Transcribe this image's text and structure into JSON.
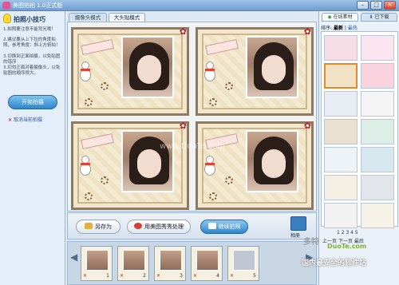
{
  "window": {
    "title": "美图拍拍 1.0正式版",
    "btn_min": "–",
    "btn_max": "□",
    "btn_close": "×"
  },
  "tips": {
    "title": "拍照小技巧",
    "items": [
      "1.拍照要注意不能背光哦！",
      "2.建议要从上下拉的角度拍照，参考角度：斜上方俯拍！",
      "3.切换到正面拍摄，以免贴图的错序",
      "3.切勿正面对着摄像头，以免贴图的顺序很大。"
    ]
  },
  "left": {
    "start_label": "开始拍摄",
    "cancel_label": "取消当前拍摄"
  },
  "mode_tabs": [
    {
      "label": "摄像头模式"
    },
    {
      "label": "大头贴模式"
    }
  ],
  "toolbar": {
    "save_label": "另存为",
    "edit_label": "用美图秀秀处理",
    "continue_label": "继续拍照",
    "album_label": "相册"
  },
  "thumbs": [
    {
      "number": "1"
    },
    {
      "number": "2"
    },
    {
      "number": "3"
    },
    {
      "number": "4"
    },
    {
      "number": "5"
    }
  ],
  "right": {
    "tab_online": "在线素材",
    "tab_download": "已下载",
    "sort_label": "排序:",
    "sort_newest": "最新",
    "sort_hot": "最热",
    "pages": "1  2  3  4  5",
    "prev": "上一页",
    "next": "下一页",
    "last": "最后"
  },
  "watermark": {
    "brand": "多特",
    "url": "DuoTe.com",
    "slogan": "国内最安全的软件站",
    "center": "www.DuoTe.com"
  },
  "colors": {
    "accent": "#2f86cc",
    "selected_border": "#e38b2c"
  }
}
